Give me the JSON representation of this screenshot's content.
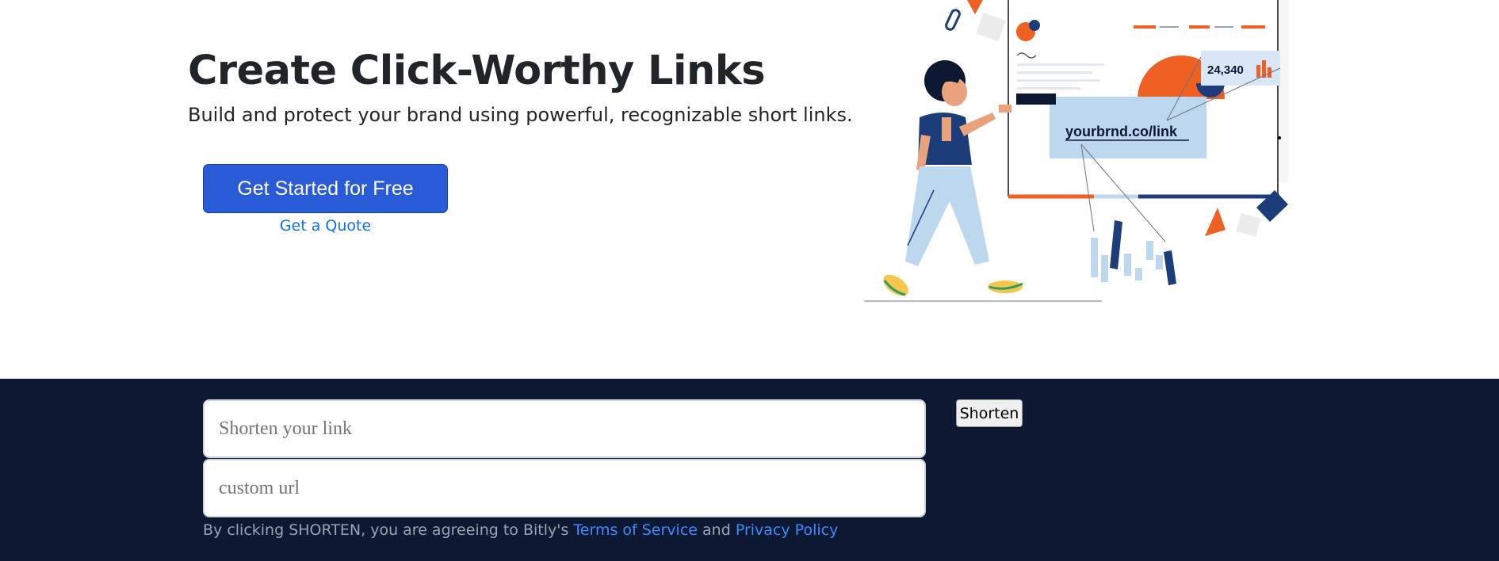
{
  "hero": {
    "title": "Create Click-Worthy Links",
    "subtitle": "Build and protect your brand using powerful, recognizable short links.",
    "cta_label": "Get Started for Free",
    "quote_link": "Get a Quote"
  },
  "illustration": {
    "short_link_text": "yourbrnd.co/link",
    "click_count": "24,340",
    "icons": [
      "paperclip-icon",
      "bar-chart-icon"
    ]
  },
  "shortener": {
    "url_placeholder": "Shorten your link",
    "custom_placeholder": "custom url",
    "shorten_label": "Shorten",
    "terms_prefix": "By clicking SHORTEN, you are agreeing to Bitly's",
    "terms_link": "Terms of Service",
    "terms_and": "and",
    "privacy_link": "Privacy Policy"
  },
  "colors": {
    "primary": "#2a5bd7",
    "link": "#0d6efd",
    "footer_bg": "#0d1833",
    "accent_orange": "#ee6123",
    "accent_navy": "#1d3c7a",
    "accent_light_blue": "#bdd7ee"
  }
}
